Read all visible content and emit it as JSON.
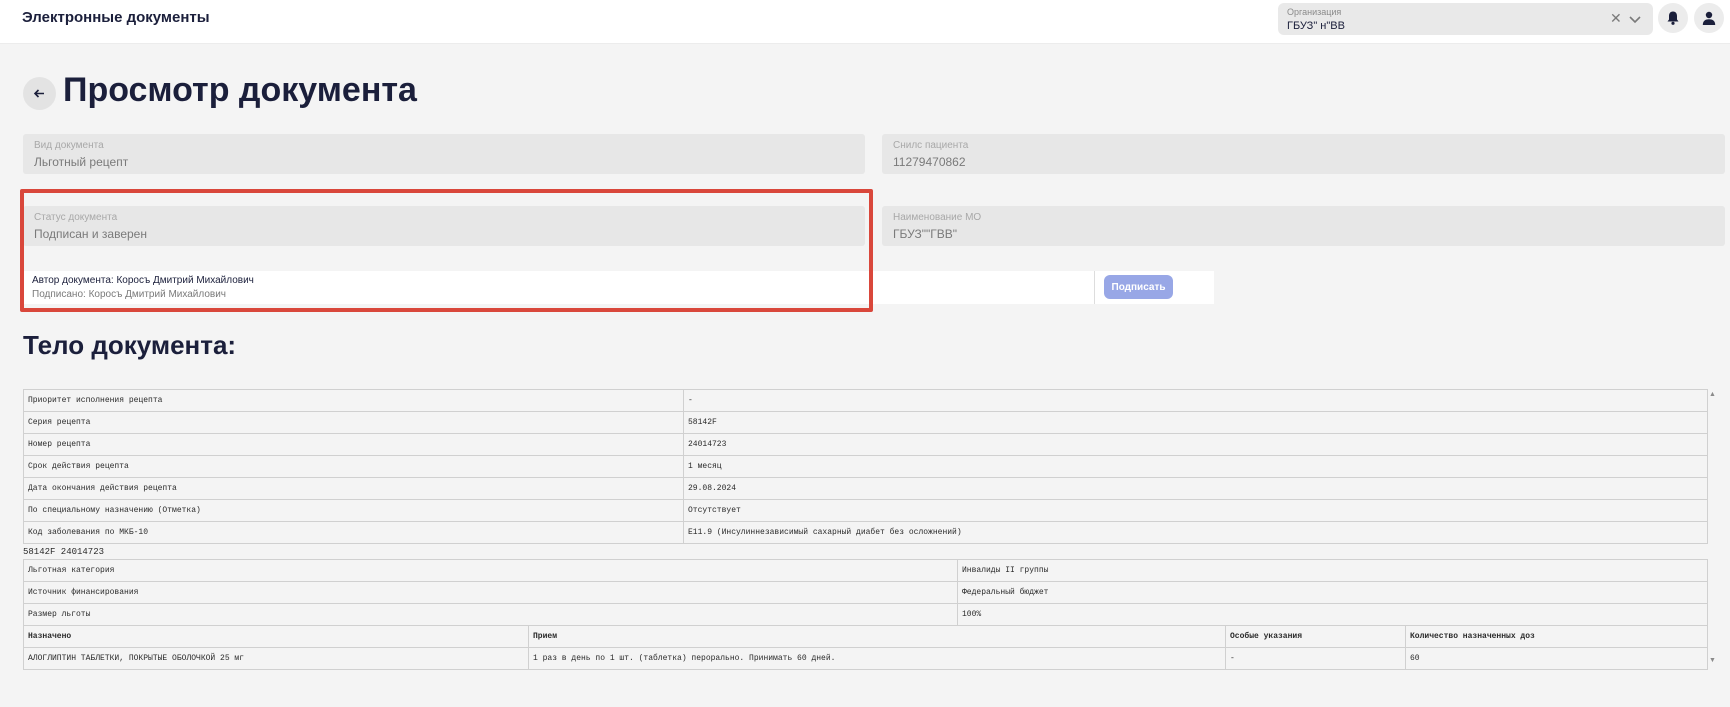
{
  "app": {
    "title": "Электронные документы"
  },
  "org": {
    "label": "Организация",
    "value": "ГБУЗ\" н\"ВВ"
  },
  "header": {
    "title": "Просмотр документа"
  },
  "fields": {
    "doc_type": {
      "label": "Вид документа",
      "value": "Льготный рецепт"
    },
    "snils": {
      "label": "Снилс пациента",
      "value": "11279470862"
    },
    "status": {
      "label": "Статус документа",
      "value": "Подписан и заверен"
    },
    "mo": {
      "label": "Наименование МО",
      "value": "ГБУЗ\"\"ГВВ\""
    }
  },
  "author": {
    "label": "Автор документа:",
    "name": "Коросъ Дмитрий Михайлович",
    "signed_label": "Подписано:",
    "signed_name": "Коросъ Дмитрий Михайлович"
  },
  "sign_button": "Подписать",
  "body": {
    "title": "Тело документа:",
    "table1": [
      [
        "Приоритет исполнения рецепта",
        "-"
      ],
      [
        "Серия рецепта",
        "58142F"
      ],
      [
        "Номер рецепта",
        "24014723"
      ],
      [
        "Срок действия рецепта",
        "1 месяц"
      ],
      [
        "Дата окончания действия рецепта",
        "29.08.2024"
      ],
      [
        "По специальному назначению (Отметка)",
        "Отсутствует"
      ],
      [
        "Код заболевания по МКБ-10",
        "E11.9 (Инсулиннезависимый сахарный диабет без осложнений)"
      ]
    ],
    "series_number": "58142F 24014723",
    "table2": [
      [
        "Льготная категория",
        "Инвалиды II группы"
      ],
      [
        "Источник финансирования",
        "Федеральный бюджет"
      ],
      [
        "Размер льготы",
        "100%"
      ]
    ],
    "table3": {
      "headers": [
        "Назначено",
        "Прием",
        "Особые указания",
        "Количество назначенных доз"
      ],
      "rows": [
        [
          "АЛОГЛИПТИН ТАБЛЕТКИ, ПОКРЫТЫЕ ОБОЛОЧКОЙ 25 мг",
          "1 раз в день по 1 шт. (таблетка) перорально. Принимать 60 дней.",
          "-",
          "60"
        ]
      ]
    }
  },
  "icons": {
    "back": "arrow-left-icon",
    "bell": "bell-icon",
    "user": "user-icon",
    "clear": "close-icon",
    "caret": "chevron-down-icon"
  },
  "colors": {
    "highlight": "#d9473b",
    "sign_button": "#98a7e6",
    "title": "#1b1f3b"
  }
}
